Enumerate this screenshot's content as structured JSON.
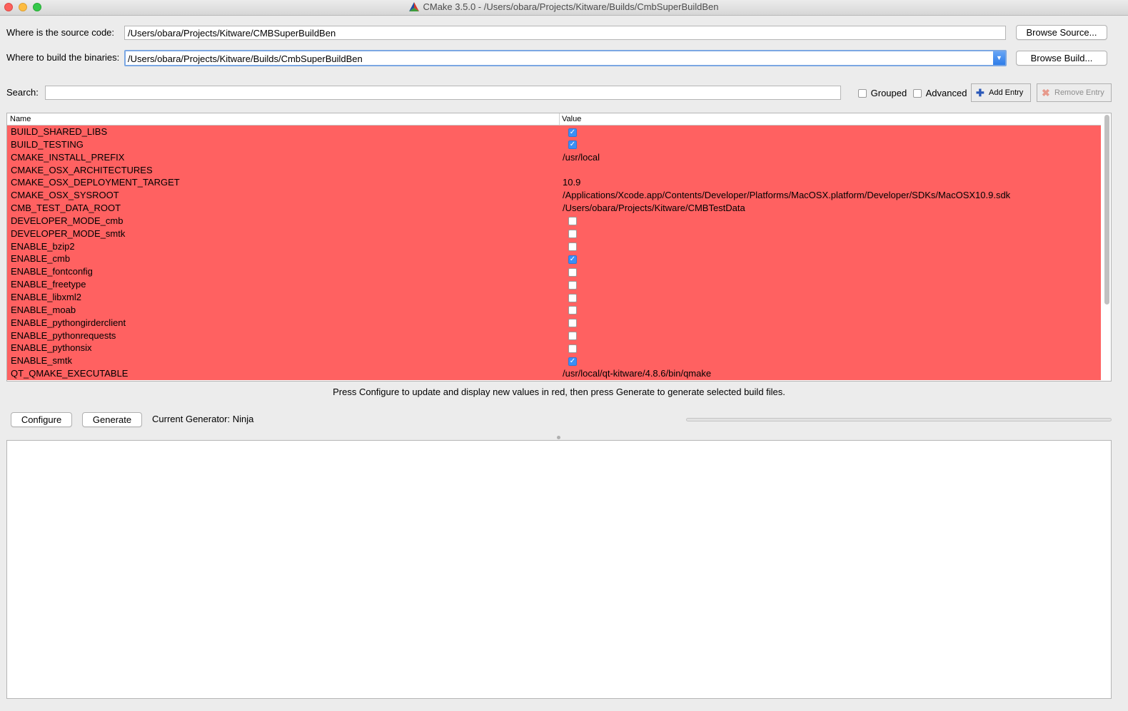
{
  "window": {
    "title": "CMake 3.5.0 - /Users/obara/Projects/Kitware/Builds/CmbSuperBuildBen"
  },
  "source": {
    "label": "Where is the source code:",
    "value": "/Users/obara/Projects/Kitware/CMBSuperBuildBen",
    "browse_label": "Browse Source..."
  },
  "build": {
    "label": "Where to build the binaries:",
    "value": "/Users/obara/Projects/Kitware/Builds/CmbSuperBuildBen",
    "browse_label": "Browse Build..."
  },
  "search": {
    "label": "Search:",
    "value": ""
  },
  "options": {
    "grouped_label": "Grouped",
    "grouped_checked": false,
    "advanced_label": "Advanced",
    "advanced_checked": false,
    "add_entry_label": "Add Entry",
    "remove_entry_label": "Remove Entry"
  },
  "table": {
    "columns": [
      "Name",
      "Value"
    ],
    "row_color": "#ff6161",
    "rows": [
      {
        "name": "BUILD_SHARED_LIBS",
        "type": "bool",
        "value": true
      },
      {
        "name": "BUILD_TESTING",
        "type": "bool",
        "value": true
      },
      {
        "name": "CMAKE_INSTALL_PREFIX",
        "type": "text",
        "value": "/usr/local"
      },
      {
        "name": "CMAKE_OSX_ARCHITECTURES",
        "type": "text",
        "value": ""
      },
      {
        "name": "CMAKE_OSX_DEPLOYMENT_TARGET",
        "type": "text",
        "value": "10.9"
      },
      {
        "name": "CMAKE_OSX_SYSROOT",
        "type": "text",
        "value": "/Applications/Xcode.app/Contents/Developer/Platforms/MacOSX.platform/Developer/SDKs/MacOSX10.9.sdk"
      },
      {
        "name": "CMB_TEST_DATA_ROOT",
        "type": "text",
        "value": "/Users/obara/Projects/Kitware/CMBTestData"
      },
      {
        "name": "DEVELOPER_MODE_cmb",
        "type": "bool",
        "value": false
      },
      {
        "name": "DEVELOPER_MODE_smtk",
        "type": "bool",
        "value": false
      },
      {
        "name": "ENABLE_bzip2",
        "type": "bool",
        "value": false
      },
      {
        "name": "ENABLE_cmb",
        "type": "bool",
        "value": true
      },
      {
        "name": "ENABLE_fontconfig",
        "type": "bool",
        "value": false
      },
      {
        "name": "ENABLE_freetype",
        "type": "bool",
        "value": false
      },
      {
        "name": "ENABLE_libxml2",
        "type": "bool",
        "value": false
      },
      {
        "name": "ENABLE_moab",
        "type": "bool",
        "value": false
      },
      {
        "name": "ENABLE_pythongirderclient",
        "type": "bool",
        "value": false
      },
      {
        "name": "ENABLE_pythonrequests",
        "type": "bool",
        "value": false
      },
      {
        "name": "ENABLE_pythonsix",
        "type": "bool",
        "value": false
      },
      {
        "name": "ENABLE_smtk",
        "type": "bool",
        "value": true
      },
      {
        "name": "QT_QMAKE_EXECUTABLE",
        "type": "text",
        "value": "/usr/local/qt-kitware/4.8.6/bin/qmake"
      }
    ]
  },
  "hint": "Press Configure to update and display new values in red, then press Generate to generate selected build files.",
  "actions": {
    "configure_label": "Configure",
    "generate_label": "Generate",
    "generator_text": "Current Generator: Ninja",
    "progress": 0
  },
  "output": {
    "text": ""
  }
}
